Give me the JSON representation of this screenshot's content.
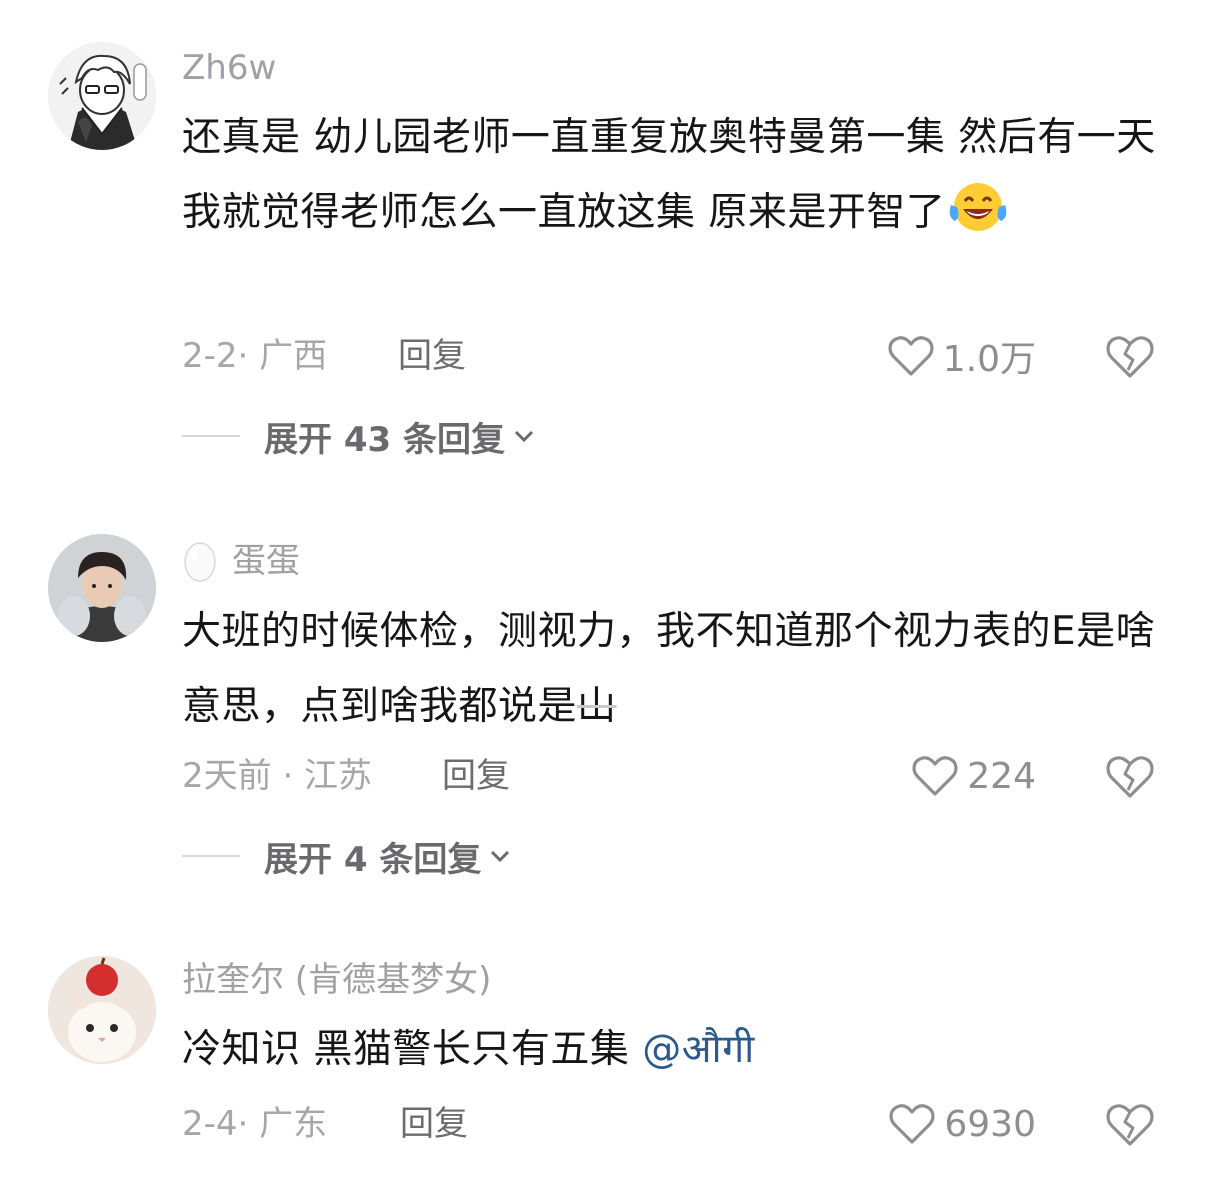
{
  "comments": [
    {
      "username": "Zh6w",
      "text": "还真是 幼儿园老师一直重复放奥特曼第一集 然后有一天我就觉得老师怎么一直放这集 原来是开智了",
      "emoji": "laughing-crying-emoji",
      "meta": "2-2· 广西",
      "reply_label": "回复",
      "likes": "1.0万",
      "expand_label": "展开 43 条回复"
    },
    {
      "username": "蛋蛋",
      "badge": "egg-icon",
      "text": "大班的时候体检，测视力，我不知道那个视力表的E是啥意思，点到啥我都说是",
      "text_tail": "山",
      "meta": "2天前 · 江苏",
      "reply_label": "回复",
      "likes": "224",
      "expand_label": "展开 4 条回复"
    },
    {
      "username": "拉奎尔 (肯德基梦女)",
      "text": "冷知识 黑猫警长只有五集 ",
      "mention": "@औगी",
      "meta": "2-4· 广东",
      "reply_label": "回复",
      "likes": "6930"
    }
  ],
  "colors": {
    "accent_mention": "#2c5a8c",
    "meta_gray": "#a6a6ab",
    "text": "#161616"
  }
}
